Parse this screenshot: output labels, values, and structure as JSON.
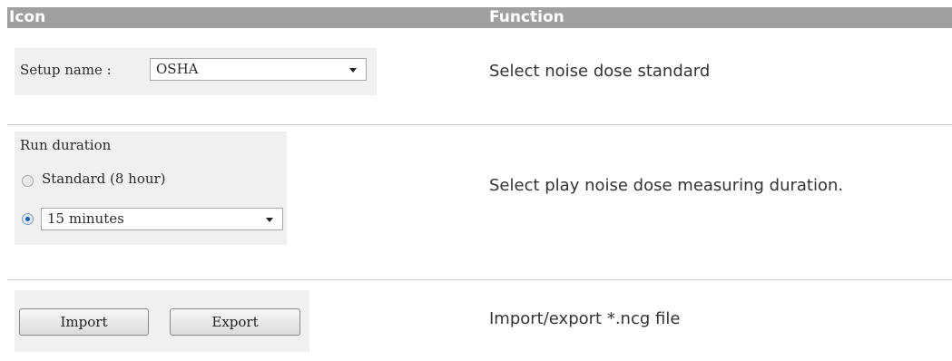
{
  "header": {
    "icon_col": "Icon",
    "function_col": "Function"
  },
  "rows": [
    {
      "widget": {
        "setup_label": "Setup name :",
        "setup_value": "OSHA"
      },
      "function": "Select noise dose standard"
    },
    {
      "widget": {
        "group_label": "Run duration",
        "option_standard": "Standard (8 hour)",
        "option_custom_value": "15 minutes"
      },
      "function": "Select play noise dose measuring duration."
    },
    {
      "widget": {
        "import_label": "Import",
        "export_label": "Export"
      },
      "function": "Import/export *.ncg file"
    }
  ],
  "colors": {
    "header_bg": "#a0a0a0",
    "header_text": "#ffffff",
    "panel_bg": "#f0f0f0",
    "radio_selected": "#1f5fa8"
  }
}
